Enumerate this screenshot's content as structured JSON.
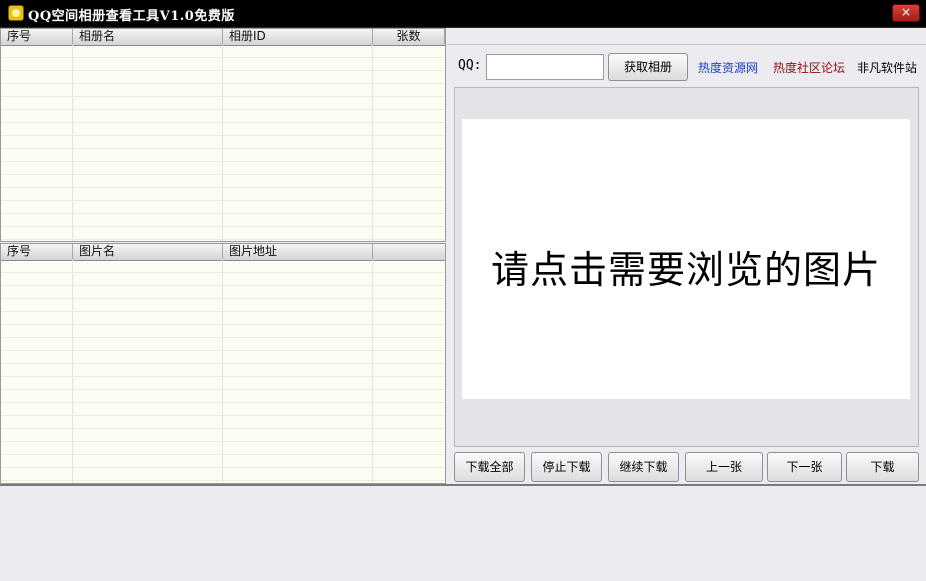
{
  "window": {
    "title": "QQ空间相册查看工具V1.0免费版",
    "close_glyph": "×"
  },
  "album_list": {
    "columns": [
      "序号",
      "相册名",
      "相册ID",
      "张数"
    ],
    "rows": []
  },
  "photo_list": {
    "columns": [
      "序号",
      "图片名",
      "图片地址",
      ""
    ],
    "rows": []
  },
  "qq": {
    "label": "QQ:",
    "value": "",
    "fetch_button": "获取相册"
  },
  "links": [
    "热度资源网",
    "热度社区论坛",
    "非凡软件站"
  ],
  "viewer": {
    "placeholder": "请点击需要浏览的图片"
  },
  "actions": [
    "下载全部",
    "停止下载",
    "继续下载",
    "上一张",
    "下一张",
    "下载"
  ],
  "colors": {
    "titlebar": "#000000",
    "link_blue": "#1a3ec8",
    "link_red": "#8b1010"
  }
}
